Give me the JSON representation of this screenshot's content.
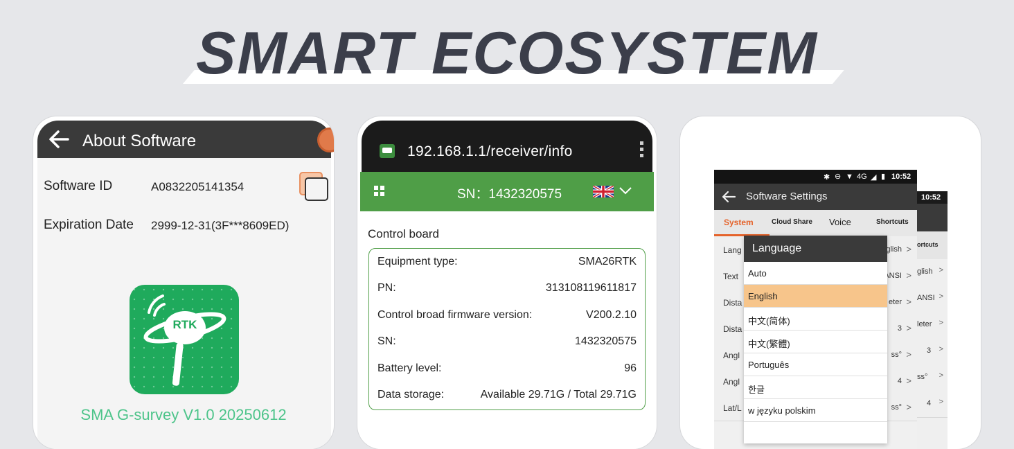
{
  "banner": {
    "title": "SMART ECOSYSTEM"
  },
  "phone1": {
    "header_title": "About Software",
    "rows": [
      {
        "label": "Software ID",
        "value": "A0832205141354"
      },
      {
        "label": "Expiration Date",
        "value": "2999-12-31(3F***8609ED)"
      }
    ],
    "logo_text": "RTK",
    "app_caption": "SMA G-survey V1.0 20250612"
  },
  "phone2": {
    "url": "192.168.1.1/receiver/info",
    "sn_bar": "SN：1432320575",
    "section_title": "Control board",
    "rows": [
      {
        "label": "Equipment type:",
        "value": "SMA26RTK"
      },
      {
        "label": "PN:",
        "value": "313108119611817"
      },
      {
        "label": "Control broad firmware version:",
        "value": "V200.2.10"
      },
      {
        "label": "SN:",
        "value": "1432320575"
      },
      {
        "label": "Battery level:",
        "value": "96"
      },
      {
        "label": "Data storage:",
        "value": "Available 29.71G / Total 29.71G"
      }
    ]
  },
  "phone3": {
    "status_network": "4G",
    "status_time": "10:52",
    "back_status_time": "10:52",
    "back_tab": "ortcuts",
    "back_rows": [
      "glish",
      "ANSI",
      "leter",
      "3",
      "ss°",
      "4"
    ],
    "header_title": "Software Settings",
    "tabs": [
      "System",
      "Cloud Share",
      "Voice",
      "Shortcuts"
    ],
    "rows": [
      {
        "label": "Lang",
        "value": "glish"
      },
      {
        "label": "Text",
        "value": "ANSI"
      },
      {
        "label": "Dista",
        "value": "eter"
      },
      {
        "label": "Dista",
        "value": "3"
      },
      {
        "label": "Angl",
        "value": "ss°"
      },
      {
        "label": "Angl",
        "value": "4"
      },
      {
        "label": "Lat/L",
        "value": "ss°"
      }
    ],
    "dialog_title": "Language",
    "options": [
      "Auto",
      "English",
      "中文(简体)",
      "中文(繁體)",
      "Português",
      "한글",
      "w języku polskim"
    ],
    "selected_option_index": 1,
    "accent_color": "#e5632b"
  }
}
